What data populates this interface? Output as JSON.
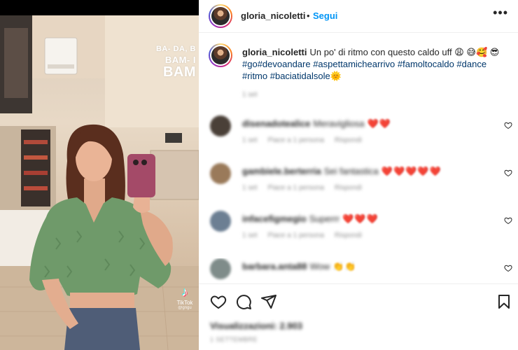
{
  "post": {
    "author": "gloria_nicoletti",
    "separator": "•",
    "follow_label": "Segui",
    "more_icon": "more-horizontal-icon",
    "media": {
      "overlay_lines": [
        "BA- DA, B",
        "BAM- I",
        "BAM"
      ],
      "watermark": {
        "label": "TikTok",
        "user": "@gngu"
      }
    },
    "caption": {
      "user": "gloria_nicoletti",
      "text": "Un po' di ritmo con questo caldo uff",
      "emojis_1": "😩 😅🥰",
      "emojis_2": "😎",
      "hashtags": "#go#devoandare #aspettamichearrivo #famoltocaldo #dance #ritmo #baciatidalsole",
      "end_emoji": "🌞",
      "age": "1 set"
    },
    "comments": [
      {
        "user": "disenadotealice",
        "body": "Meravigliosa",
        "emojis": "❤️❤️",
        "meta": [
          "1 set",
          "Piace a 1 persona",
          "Rispondi"
        ],
        "avatar_color": "#4a4038"
      },
      {
        "user": "gambiele.berterria",
        "body": "Sei fantastica",
        "emojis": "❤️❤️❤️❤️❤️",
        "meta": [
          "1 set",
          "Piace a 1 persona",
          "Rispondi"
        ],
        "avatar_color": "#9a7a5a"
      },
      {
        "user": "infacefigmegio",
        "body": "Superrr",
        "emojis": "❤️❤️❤️",
        "meta": [
          "1 set",
          "Piace a 1 persona",
          "Rispondi"
        ],
        "avatar_color": "#6c7f93"
      },
      {
        "user": "barbara.anta88",
        "body": "Wow",
        "emojis": "👏👏",
        "meta": [],
        "avatar_color": "#7f8c8a"
      }
    ],
    "actions": {
      "like_icon": "heart-outline-icon",
      "comment_icon": "comment-bubble-icon",
      "share_icon": "paper-plane-icon",
      "save_icon": "bookmark-icon"
    },
    "views": "Visualizzazioni: 2.903",
    "date": "1 SETTEMBRE"
  }
}
